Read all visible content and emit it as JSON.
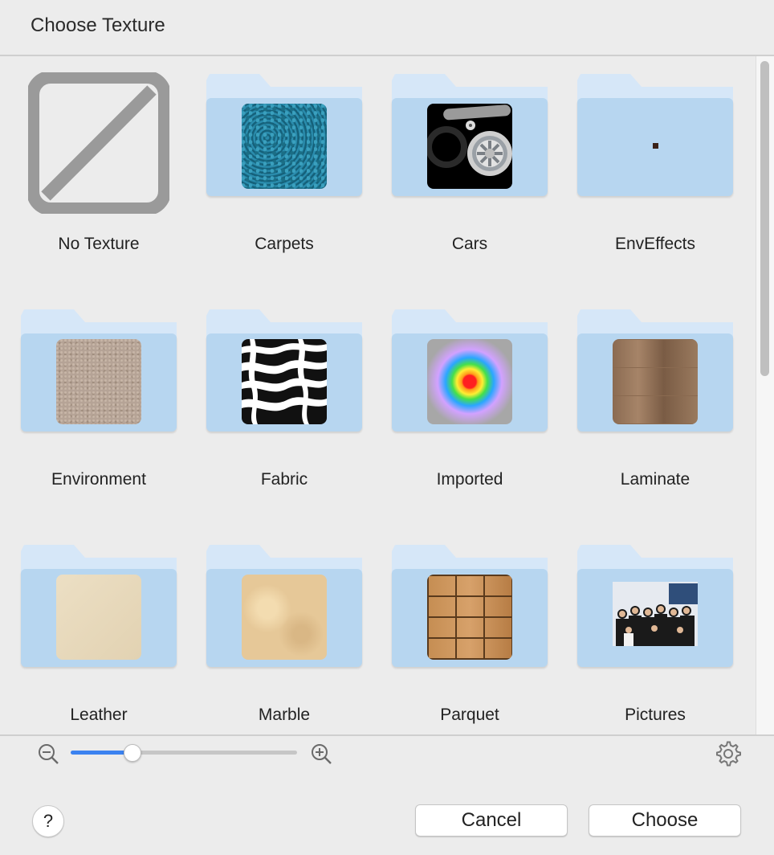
{
  "dialog": {
    "title": "Choose Texture"
  },
  "items": [
    {
      "label": "No Texture",
      "kind": "no-texture-icon"
    },
    {
      "label": "Carpets",
      "kind": "folder",
      "thumb": "carpet"
    },
    {
      "label": "Cars",
      "kind": "folder",
      "thumb": "cars"
    },
    {
      "label": "EnvEffects",
      "kind": "folder",
      "thumb": "empty"
    },
    {
      "label": "Environment",
      "kind": "folder",
      "thumb": "env"
    },
    {
      "label": "Fabric",
      "kind": "folder",
      "thumb": "fabric"
    },
    {
      "label": "Imported",
      "kind": "folder",
      "thumb": "imported"
    },
    {
      "label": "Laminate",
      "kind": "folder",
      "thumb": "laminate"
    },
    {
      "label": "Leather",
      "kind": "folder",
      "thumb": "leather"
    },
    {
      "label": "Marble",
      "kind": "folder",
      "thumb": "marble"
    },
    {
      "label": "Parquet",
      "kind": "folder",
      "thumb": "parquet"
    },
    {
      "label": "Pictures",
      "kind": "folder",
      "thumb": "pictures"
    }
  ],
  "zoom": {
    "value": 0.27,
    "out_icon": "zoom-out-icon",
    "in_icon": "zoom-in-icon"
  },
  "settings": {
    "icon": "gear-icon"
  },
  "footer": {
    "help_label": "?",
    "cancel_label": "Cancel",
    "choose_label": "Choose"
  },
  "colors": {
    "accent": "#3b82f0",
    "folder_body": "#b7d6f0",
    "folder_tab": "#d6e7f8"
  }
}
